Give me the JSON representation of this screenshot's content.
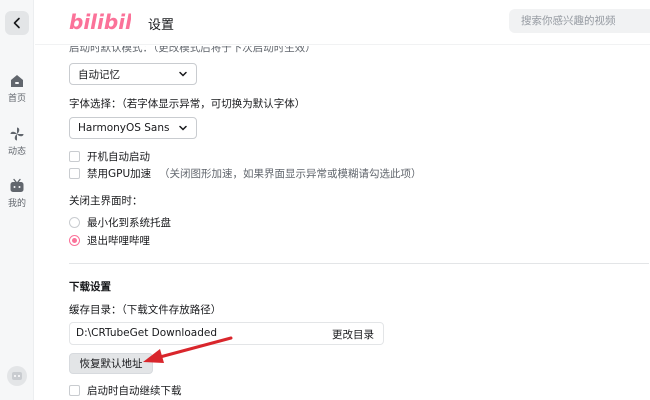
{
  "header": {
    "logo_text": "bilibili",
    "title": "设置",
    "search_placeholder": "搜索你感兴趣的视频"
  },
  "nav": {
    "items": [
      {
        "label": "首页",
        "icon": "home-icon"
      },
      {
        "label": "动态",
        "icon": "pinwheel-icon"
      },
      {
        "label": "我的",
        "icon": "tv-icon"
      }
    ]
  },
  "settings": {
    "startup_mode_label_cut": "启动时les模式：（更改模式后将于下次启动时生效）",
    "startup_mode_value": "自动记忆",
    "font_label": "字体选择：（若字体显示异常，可切换为默认字体）",
    "font_value": "HarmonyOS Sans",
    "auto_start_label": "开机自动启动",
    "disable_gpu_label": "禁用GPU加速",
    "disable_gpu_note": "（关闭图形加速，如果界面显示异常或模糊请勾选此项）",
    "close_label": "关闭主界面时：",
    "close_options": [
      {
        "label": "最小化到系统托盘",
        "selected": false
      },
      {
        "label": "退出哔哩哔哩",
        "selected": true
      }
    ]
  },
  "download": {
    "section_title": "下载设置",
    "cache_label": "缓存目录：（下载文件存放路径）",
    "path_value": "D:\\CRTubeGet Downloaded",
    "change_dir_label": "更改目录",
    "restore_default_label": "恢复默认地址",
    "resume_on_start_label": "启动时自动继续下载"
  },
  "colors": {
    "accent": "#fb7299",
    "annotation_arrow": "#d9262c"
  }
}
